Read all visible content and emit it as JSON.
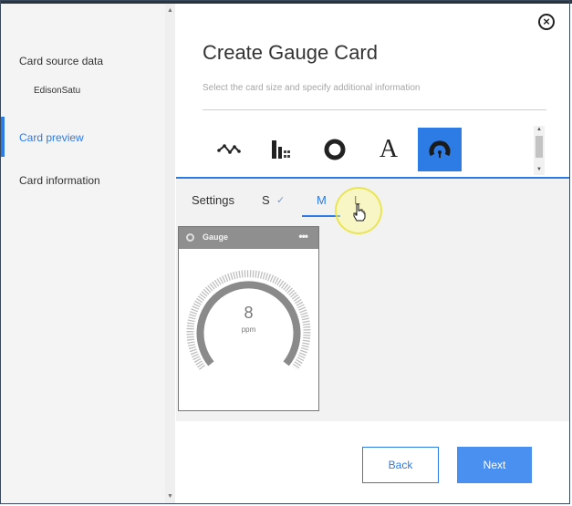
{
  "sidebar": {
    "items": [
      {
        "label": "Card source data"
      },
      {
        "label": "EdisonSatu"
      },
      {
        "label": "Card preview"
      },
      {
        "label": "Card information"
      }
    ]
  },
  "header": {
    "title": "Create Gauge Card",
    "subtitle": "Select the card size and specify additional information",
    "close_symbol": "×"
  },
  "card_types": [
    {
      "icon": "line-chart-icon"
    },
    {
      "icon": "bar-table-icon"
    },
    {
      "icon": "donut-icon"
    },
    {
      "icon": "text-icon",
      "glyph": "A"
    },
    {
      "icon": "gauge-icon",
      "selected": true
    }
  ],
  "tabs": [
    {
      "label": "Settings"
    },
    {
      "label": "S"
    },
    {
      "label": "M",
      "active": true
    },
    {
      "label": "L"
    }
  ],
  "check_glyph": "✓",
  "gauge_card": {
    "title": "Gauge",
    "menu": "•••",
    "value": "8",
    "unit": "ppm"
  },
  "footer": {
    "back_label": "Back",
    "next_label": "Next"
  },
  "colors": {
    "accent": "#2d7be5",
    "next_button": "#4a90f0",
    "card_header": "#8f8f8f"
  }
}
